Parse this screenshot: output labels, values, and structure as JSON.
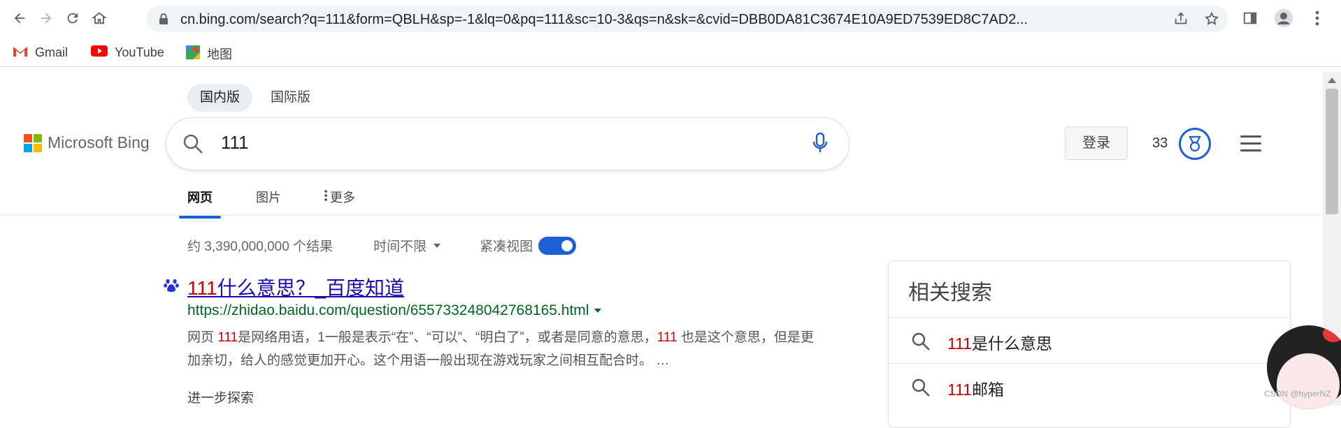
{
  "browser": {
    "url": "cn.bing.com/search?q=111&form=QBLH&sp=-1&lq=0&pq=111&sc=10-3&qs=n&sk=&cvid=DBB0DA81C3674E10A9ED7539ED8C7AD2...",
    "bookmarks": [
      {
        "label": "Gmail",
        "icon": "gmail-icon"
      },
      {
        "label": "YouTube",
        "icon": "youtube-icon"
      },
      {
        "label": "地图",
        "icon": "maps-icon"
      }
    ]
  },
  "bing": {
    "region_tabs": [
      "国内版",
      "国际版"
    ],
    "logo_text": "Microsoft Bing",
    "query": "111",
    "login_label": "登录",
    "points": "33",
    "scope_tabs": [
      "网页",
      "图片",
      "更多"
    ]
  },
  "results_meta": {
    "count": "约 3,390,000,000 个结果",
    "time_filter": "时间不限",
    "compact_view": "紧凑视图"
  },
  "result1": {
    "title_hl": "111",
    "title_rest": "什么意思？_百度知道",
    "url": "https://zhidao.baidu.com/question/655733248042768165.html",
    "snippet_prefix": "网页 ",
    "snippet_hl1": "111",
    "snippet_mid": "是网络用语，1一般是表示“在”、“可以”、“明白了”，或者是同意的意思，",
    "snippet_hl2": "111",
    "snippet_suffix": " 也是这个意思，但是更加亲切，给人的感觉更加开心。这个用语一般出现在游戏玩家之间相互配合时。 …",
    "further": "进一步探索"
  },
  "related": {
    "title": "相关搜索",
    "items": [
      {
        "hl": "111",
        "rest": "是什么意思"
      },
      {
        "hl": "111",
        "rest": "邮箱"
      }
    ]
  },
  "watermark": "CSDN @hyperNZ",
  "colors": {
    "accent": "#1f5fd6",
    "link": "#1a0dab",
    "url": "#006621",
    "highlight": "#c80000"
  }
}
